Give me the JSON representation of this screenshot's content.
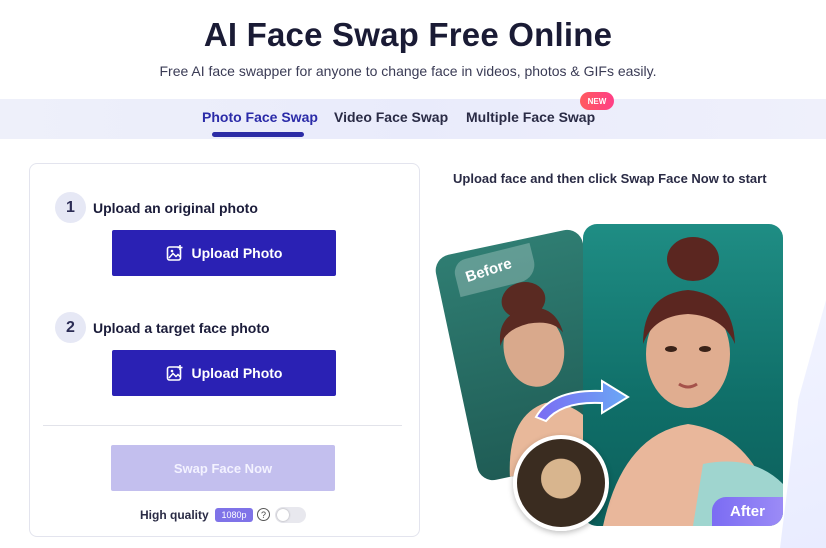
{
  "header": {
    "title": "AI Face Swap Free Online",
    "subtitle": "Free AI face swapper for anyone to change face in videos, photos & GIFs easily."
  },
  "tabs": [
    {
      "label": "Photo Face Swap",
      "active": true
    },
    {
      "label": "Video Face Swap",
      "active": false
    },
    {
      "label": "Multiple Face Swap",
      "active": false,
      "badge": "NEW"
    }
  ],
  "upload_panel": {
    "step1": {
      "number": "1",
      "label": "Upload an original photo",
      "button": "Upload Photo"
    },
    "step2": {
      "number": "2",
      "label": "Upload a target face photo",
      "button": "Upload Photo"
    },
    "swap_button": "Swap Face Now",
    "quality": {
      "label": "High quality",
      "resolution": "1080p",
      "help": "?",
      "enabled": false
    }
  },
  "preview": {
    "hint": "Upload face and then click Swap Face Now to start",
    "before_label": "Before",
    "after_label": "After"
  },
  "colors": {
    "accent": "#2a21b4",
    "disabled": "#c3bfee",
    "badge": "#ff4f70"
  }
}
